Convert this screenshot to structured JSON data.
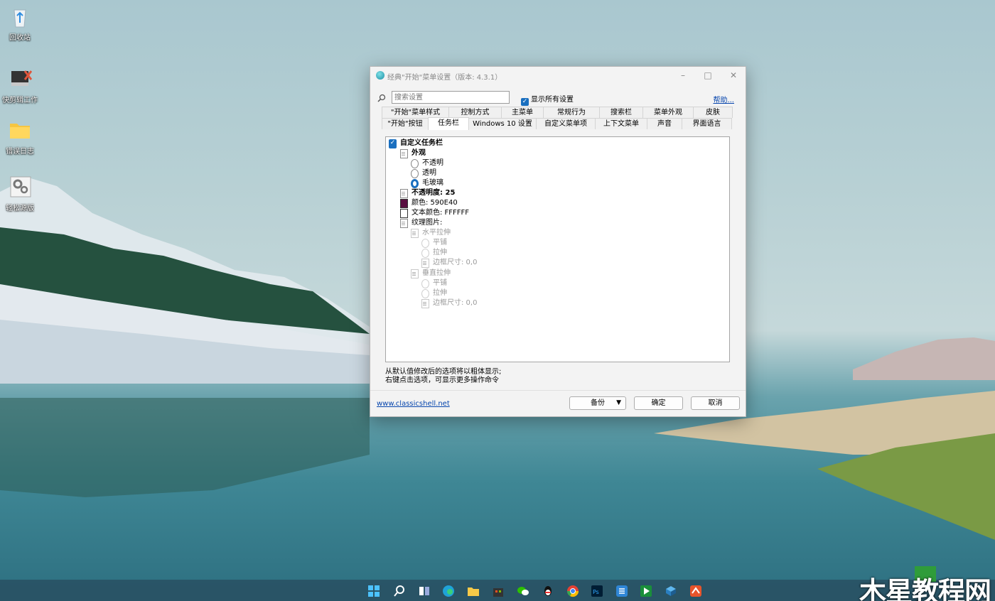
{
  "desktop": {
    "icons": [
      {
        "label": "回收站",
        "icon": "recycle-bin-icon"
      },
      {
        "label": "快剪辑工作",
        "icon": "video-editor-icon"
      },
      {
        "label": "错误日志",
        "icon": "folder-icon"
      },
      {
        "label": "轻松源版",
        "icon": "settings-gear-icon"
      }
    ]
  },
  "dialog": {
    "title": "经典\"开始\"菜单设置（版本: 4.3.1）",
    "search_placeholder": "搜索设置",
    "show_all_label": "显示所有设置",
    "show_all_checked": true,
    "help_link": "帮助...",
    "tabs_row1": [
      "\"开始\"菜单样式",
      "控制方式",
      "主菜单",
      "常规行为",
      "搜索栏",
      "菜单外观",
      "皮肤"
    ],
    "tabs_row2": [
      "\"开始\"按钮",
      "任务栏",
      "Windows 10 设置",
      "自定义菜单项",
      "上下文菜单",
      "声音",
      "界面语言"
    ],
    "active_tab": "任务栏",
    "tree": {
      "custom_taskbar": "自定义任务栏",
      "appearance": "外观",
      "opaque": "不透明",
      "transparent": "透明",
      "glass": "毛玻璃",
      "opacity": "不透明度: 25",
      "color": "颜色: 590E40",
      "color_hex": "#590E40",
      "text_color": "文本颜色: FFFFFF",
      "text_color_hex": "#FFFFFF",
      "texture": "纹理图片:",
      "h_stretch": "水平拉伸",
      "h_tile": "平铺",
      "h_stretch_opt": "拉伸",
      "h_border": "边框尺寸: 0,0",
      "v_stretch": "垂直拉伸",
      "v_tile": "平铺",
      "v_stretch_opt": "拉伸",
      "v_border": "边框尺寸: 0,0"
    },
    "hint_line1": "从默认值修改后的选项将以粗体显示;",
    "hint_line2": "右键点击选项，可显示更多操作命令",
    "site_link": "www.classicshell.net",
    "backup_label": "备份",
    "ok_label": "确定",
    "cancel_label": "取消"
  },
  "taskbar": {
    "icons": [
      "start-icon",
      "search-icon",
      "task-view-icon",
      "edge-icon",
      "file-explorer-icon",
      "store-icon",
      "wechat-icon",
      "qq-icon",
      "chrome-icon",
      "photoshop-icon",
      "app-icon",
      "media-player-icon",
      "network-icon",
      "app-red-icon"
    ]
  },
  "watermark": "木星教程网",
  "colors": {
    "accent": "#1A6FBF",
    "link": "#0645AD"
  }
}
